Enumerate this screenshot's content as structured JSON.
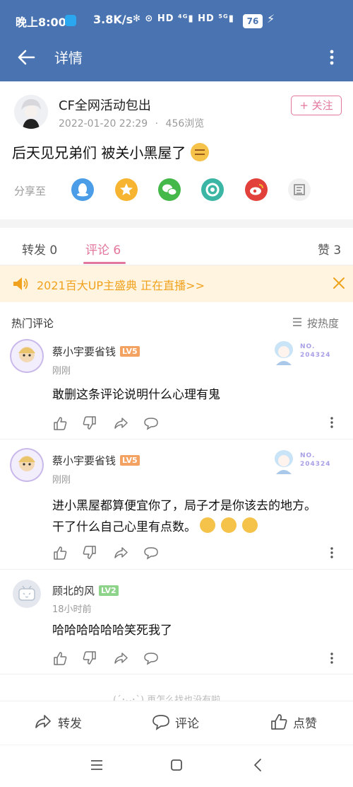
{
  "status_bar": {
    "time": "晚上8:00",
    "speed": "3.8K/s",
    "icons_text": "✻ ⊙ HD ⁴ᴳ▮ HD ⁵ᴳ▮",
    "battery": "76"
  },
  "header": {
    "title": "详情"
  },
  "post": {
    "author": "CF全网活动包出",
    "date": "2022-01-20 22:29",
    "views": "456浏览",
    "follow_label": "+ 关注",
    "text": "后天见兄弟们 被关小黑屋了"
  },
  "share": {
    "label": "分享至",
    "targets": [
      "qq",
      "qzone",
      "wechat",
      "moments",
      "weibo",
      "copy"
    ]
  },
  "tabs": [
    {
      "label": "转发 0"
    },
    {
      "label": "评论 6"
    },
    {
      "label": "赞 3"
    }
  ],
  "banner": {
    "text": "2021百大UP主盛典 正在直播>>"
  },
  "comments_header": {
    "hot": "热门评论",
    "sort": "按热度"
  },
  "comments": [
    {
      "user": "蔡小宇要省钱",
      "level": "LV5",
      "time": "刚刚",
      "badge_no": "NO.",
      "badge_id": "204324",
      "text_line1": "敢删这条评论说明什么心理有鬼",
      "text_line2": ""
    },
    {
      "user": "蔡小宇要省钱",
      "level": "LV5",
      "time": "刚刚",
      "badge_no": "NO.",
      "badge_id": "204324",
      "text_line1": "进小黑屋都算便宜你了，局子才是你该去的地方。",
      "text_line2": "干了什么自己心里有点数。"
    },
    {
      "user": "顾北的风",
      "level": "LV2",
      "time": "18小时前",
      "text_line1": "哈哈哈哈哈哈笑死我了",
      "text_line2": ""
    }
  ],
  "end_text": "(´･ᴗ･`) 再怎么找也没有啦",
  "bottom_bar": {
    "repost": "转发",
    "comment": "评论",
    "like": "点赞"
  },
  "colors": {
    "header": "#4a74b1",
    "accent": "#e3769c",
    "banner_text": "#f0a21e",
    "lv5": "#f4a261",
    "lv2": "#8ed38a"
  }
}
